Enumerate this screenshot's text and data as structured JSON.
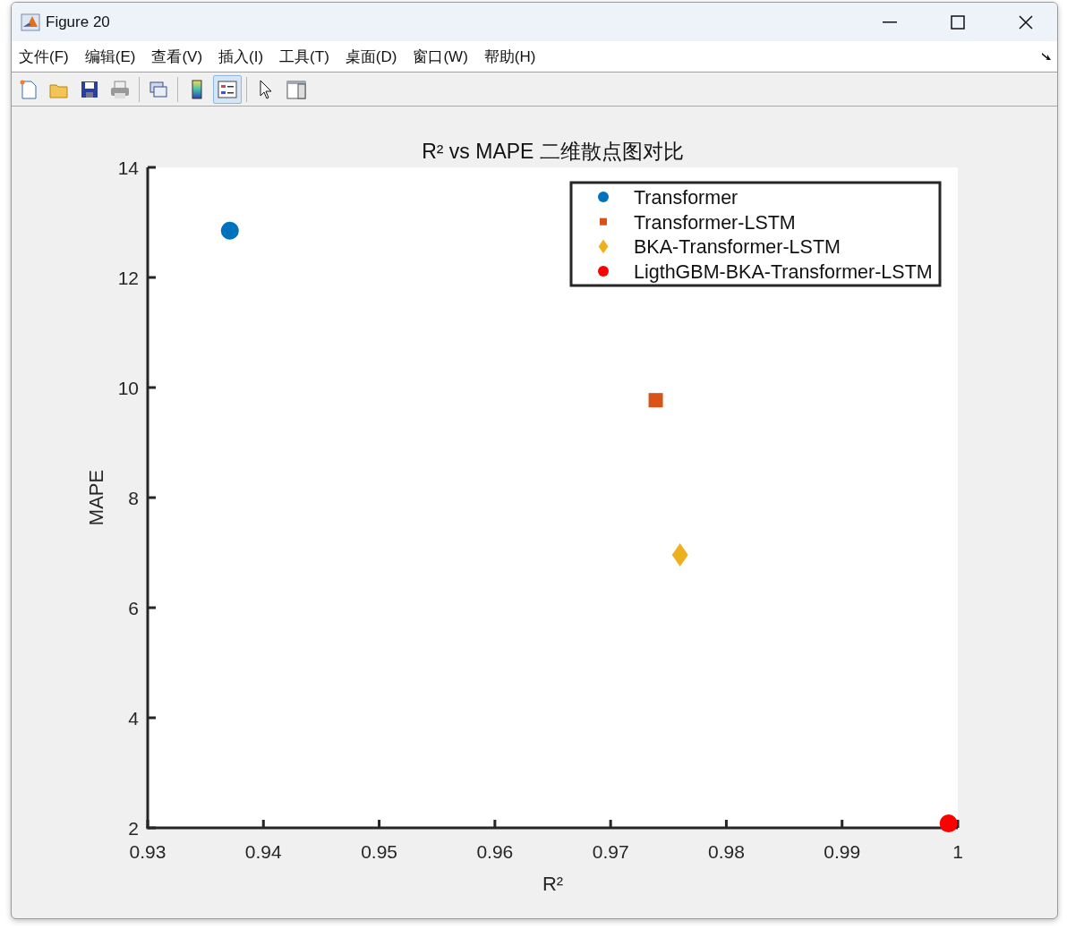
{
  "window": {
    "title": "Figure 20"
  },
  "menu": [
    {
      "label": "文件(F)"
    },
    {
      "label": "编辑(E)"
    },
    {
      "label": "查看(V)"
    },
    {
      "label": "插入(I)"
    },
    {
      "label": "工具(T)"
    },
    {
      "label": "桌面(D)"
    },
    {
      "label": "窗口(W)"
    },
    {
      "label": "帮助(H)"
    }
  ],
  "toolbar": [
    {
      "kind": "new",
      "selected": false
    },
    {
      "kind": "open",
      "selected": false
    },
    {
      "kind": "save",
      "selected": false
    },
    {
      "kind": "print",
      "selected": false
    },
    {
      "kind": "link",
      "selected": false
    },
    {
      "kind": "colorbar",
      "selected": false
    },
    {
      "kind": "legend",
      "selected": true
    },
    {
      "kind": "pointer",
      "selected": false
    },
    {
      "kind": "inspector",
      "selected": false
    }
  ],
  "chart_data": {
    "type": "scatter",
    "title": "R² vs MAPE 二维散点图对比",
    "xlabel": "R²",
    "ylabel": "MAPE",
    "xlim": [
      0.93,
      1
    ],
    "ylim": [
      2,
      14
    ],
    "xticks": [
      0.93,
      0.94,
      0.95,
      0.96,
      0.97,
      0.98,
      0.99,
      1
    ],
    "yticks": [
      2,
      4,
      6,
      8,
      10,
      12,
      14
    ],
    "legend": true,
    "series": [
      {
        "name": "Transformer",
        "color": "#0072bd",
        "x": [
          0.9371
        ],
        "values": [
          12.85
        ]
      },
      {
        "name": "Transformer-LSTM",
        "color": "#d95319",
        "x": [
          0.9739
        ],
        "values": [
          9.77
        ]
      },
      {
        "name": "BKA-Transformer-LSTM",
        "color": "#edb120",
        "x": [
          0.976
        ],
        "values": [
          6.96
        ]
      },
      {
        "name": "LigthGBM-BKA-Transformer-LSTM",
        "color": "#ff0000",
        "x": [
          0.9992
        ],
        "values": [
          2.08
        ]
      }
    ]
  }
}
